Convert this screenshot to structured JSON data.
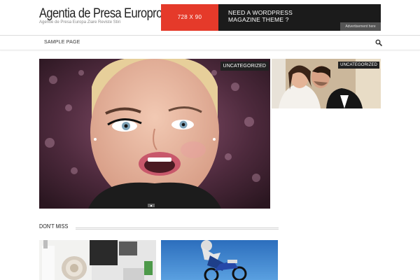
{
  "site": {
    "title": "Agentia de Presa Europro",
    "tagline": "Agentie de Presa Europa Ziare Reviste Stiri"
  },
  "banner": {
    "size_label": "728 X 90",
    "headline_line1": "NEED A WORDPRESS",
    "headline_line2": "MAGAZINE THEME ?",
    "tag": "Advertisement here"
  },
  "nav": {
    "items": [
      {
        "label": "SAMPLE PAGE"
      }
    ],
    "search_icon": "search-icon"
  },
  "featured": {
    "main_category": "UNCATEGORIZED",
    "side_category": "UNCATEGORIZED"
  },
  "dont_miss": {
    "title": "DON'T MISS"
  },
  "colors": {
    "accent_red": "#e53a2a",
    "dark": "#222222"
  }
}
